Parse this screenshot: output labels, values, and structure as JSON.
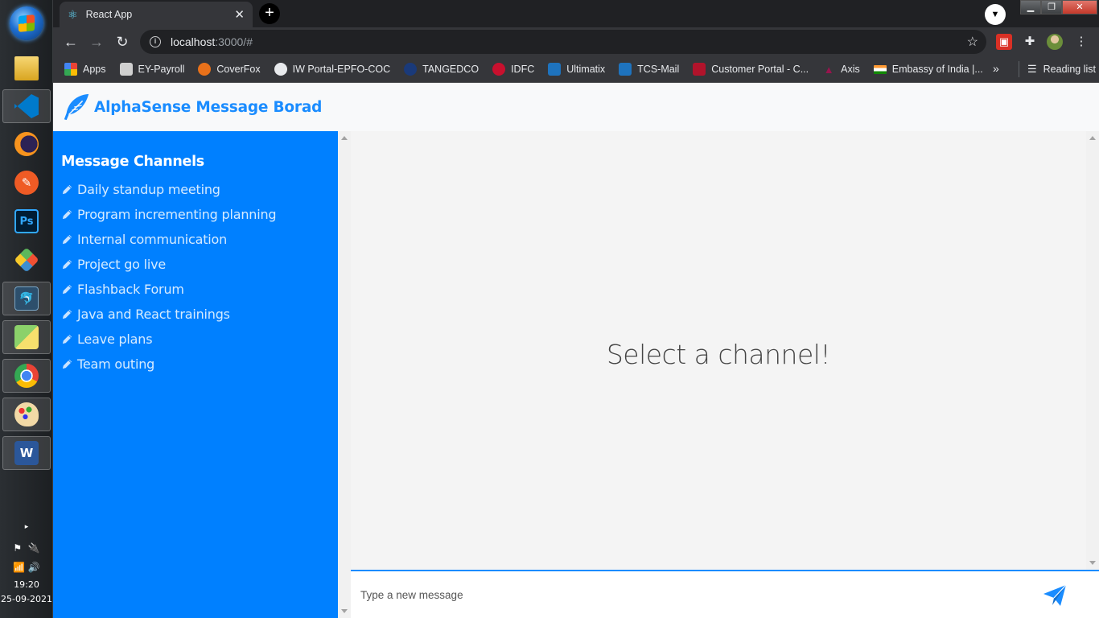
{
  "taskbar": {
    "apps": [
      {
        "icon": "file-explorer-icon"
      },
      {
        "icon": "vscode-icon"
      },
      {
        "icon": "eclipse-icon"
      },
      {
        "icon": "postman-icon"
      },
      {
        "icon": "photoshop-icon",
        "glyph": "Ps"
      },
      {
        "icon": "git-icon"
      },
      {
        "icon": "mysql-workbench-icon"
      },
      {
        "icon": "sticky-notes-icon"
      },
      {
        "icon": "chrome-icon"
      },
      {
        "icon": "paint-icon"
      },
      {
        "icon": "word-icon",
        "glyph": "W"
      }
    ],
    "time": "19:20",
    "date": "25-09-2021"
  },
  "browser": {
    "tab_title": "React App",
    "url_host": "localhost",
    "url_rest": ":3000/#",
    "bookmarks": [
      {
        "label": "Apps",
        "color": "#ea4335"
      },
      {
        "label": "EY-Payroll",
        "color": "#d0d0d0"
      },
      {
        "label": "CoverFox",
        "color": "#e8711a"
      },
      {
        "label": "IW Portal-EPFO-COC",
        "color": "#e8eaed"
      },
      {
        "label": "TANGEDCO",
        "color": "#1a3a7a"
      },
      {
        "label": "IDFC",
        "color": "#c8102e"
      },
      {
        "label": "Ultimatix",
        "color": "#1e73be"
      },
      {
        "label": "TCS-Mail",
        "color": "#1e73be"
      },
      {
        "label": "Customer Portal - C...",
        "color": "#b1132b"
      },
      {
        "label": "Axis",
        "color": "#97144d"
      },
      {
        "label": "Embassy of India |...",
        "color": "#ff9933"
      }
    ],
    "more_label": "»",
    "reading_list": "Reading list"
  },
  "app": {
    "brand": "AlphaSense Message Borad",
    "sidebar_title": "Message Channels",
    "channels": [
      "Daily standup meeting",
      "Program incrementing planning",
      "Internal communication",
      "Project go live",
      "Flashback Forum",
      "Java and React trainings",
      "Leave plans",
      "Team outing"
    ],
    "placeholder_heading": "Select a channel!",
    "input_placeholder": "Type a new message",
    "accent_color": "#0080ff"
  }
}
